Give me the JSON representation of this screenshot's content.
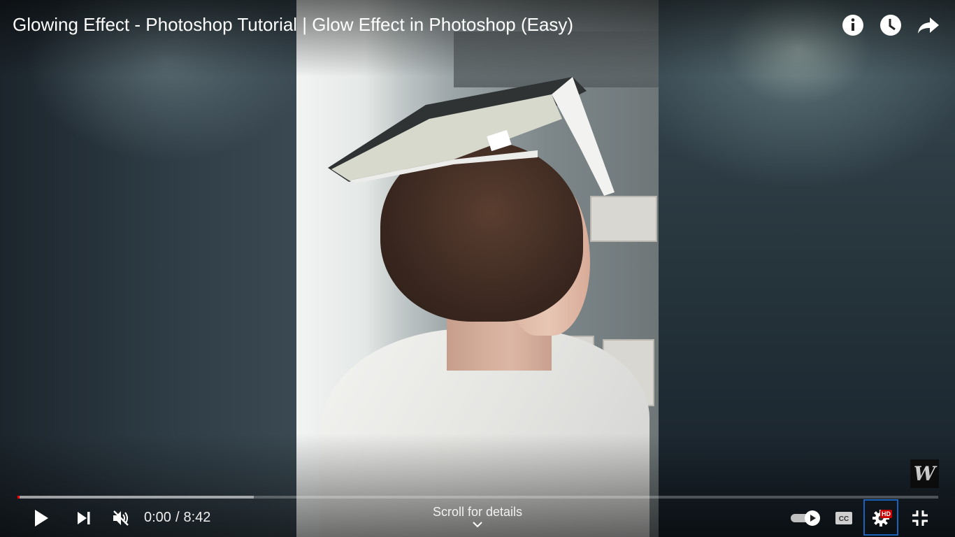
{
  "video": {
    "title": "Glowing Effect - Photoshop Tutorial | Glow Effect in Photoshop (Easy)",
    "watermark": "W"
  },
  "top_actions": [
    {
      "name": "info-icon",
      "label": "Info"
    },
    {
      "name": "watch-later-icon",
      "label": "Watch later"
    },
    {
      "name": "share-icon",
      "label": "Share"
    }
  ],
  "controls": {
    "current_time": "0:00",
    "time_separator": "/",
    "duration": "8:42",
    "scroll_hint": "Scroll for details",
    "hd_badge": "HD",
    "progress_played_fraction": 0.0,
    "progress_loaded_fraction": 0.257,
    "autoplay_on": true
  },
  "colors": {
    "progress_played": "#ff0000",
    "hd_badge": "#cc0000",
    "focus_outline": "#1c62b9"
  }
}
